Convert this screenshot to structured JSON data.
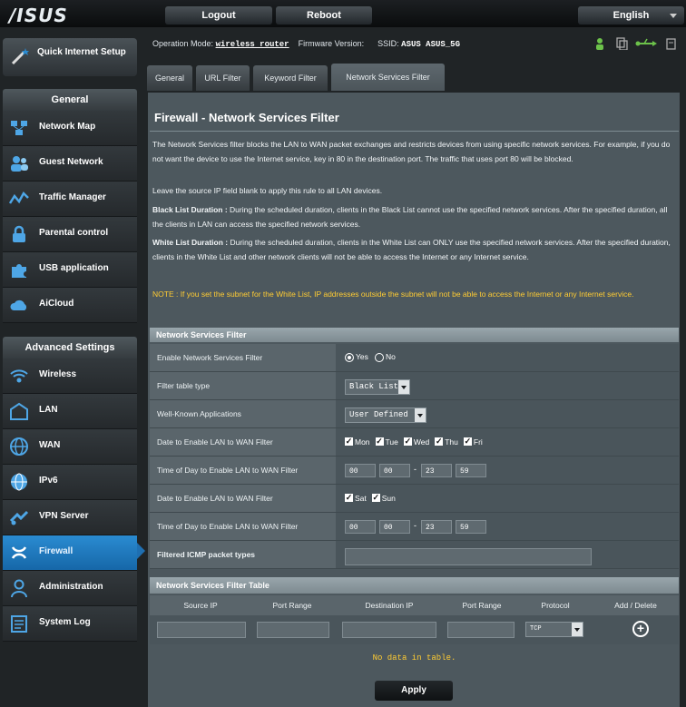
{
  "header": {
    "logo": "/ISUS",
    "logout": "Logout",
    "reboot": "Reboot",
    "language": "English"
  },
  "status": {
    "op_mode_label": "Operation Mode:",
    "op_mode_value": "wireless router",
    "firmware_label": "Firmware Version:",
    "ssid_label": "SSID:",
    "ssid_value": "ASUS  ASUS_5G"
  },
  "sidebar": {
    "quick_setup": "Quick Internet Setup",
    "general_header": "General",
    "general_items": [
      {
        "label": "Network Map",
        "icon": "network-map-icon"
      },
      {
        "label": "Guest Network",
        "icon": "guest-network-icon"
      },
      {
        "label": "Traffic Manager",
        "icon": "traffic-manager-icon"
      },
      {
        "label": "Parental control",
        "icon": "lock-icon"
      },
      {
        "label": "USB application",
        "icon": "puzzle-icon"
      },
      {
        "label": "AiCloud",
        "icon": "cloud-icon"
      }
    ],
    "advanced_header": "Advanced Settings",
    "advanced_items": [
      {
        "label": "Wireless",
        "icon": "wireless-icon"
      },
      {
        "label": "LAN",
        "icon": "lan-icon"
      },
      {
        "label": "WAN",
        "icon": "globe-icon"
      },
      {
        "label": "IPv6",
        "icon": "ipv6-globe-icon"
      },
      {
        "label": "VPN Server",
        "icon": "vpn-icon"
      },
      {
        "label": "Firewall",
        "icon": "firewall-icon",
        "active": true
      },
      {
        "label": "Administration",
        "icon": "admin-user-icon"
      },
      {
        "label": "System Log",
        "icon": "system-log-icon"
      }
    ]
  },
  "tabs": [
    {
      "label": "General"
    },
    {
      "label": "URL Filter"
    },
    {
      "label": "Keyword Filter"
    },
    {
      "label": "Network Services Filter",
      "active": true
    }
  ],
  "page": {
    "title": "Firewall - Network Services Filter",
    "intro": "The Network Services filter blocks the LAN to WAN packet exchanges and restricts devices from using specific network services. For example, if you do not want the device to use the Internet service, key in 80 in the destination port. The traffic that uses port 80 will be blocked.",
    "intro2": "Leave the source IP field blank to apply this rule to all LAN devices.",
    "black_title": "Black List Duration :",
    "black_text": "During the scheduled duration, clients in the Black List cannot use the specified network services. After the specified duration, all the clients in LAN can access the specified network services.",
    "white_title": "White List Duration :",
    "white_text": "During the scheduled duration, clients in the White List can ONLY use the specified network services. After the specified duration, clients in the White List and other network clients will not be able to access the Internet or any Internet service.",
    "note": "NOTE : If you set the subnet for the White List, IP addresses outside the subnet will not be able to access the Internet or any Internet service."
  },
  "filter_section": {
    "header": "Network Services Filter",
    "enable_label": "Enable Network Services Filter",
    "enable_yes": "Yes",
    "enable_no": "No",
    "table_type_label": "Filter table type",
    "table_type_value": "Black List",
    "well_known_label": "Well-Known Applications",
    "well_known_value": "User Defined",
    "weekday_label": "Date to Enable LAN to WAN Filter",
    "weekdays": [
      "Mon",
      "Tue",
      "Wed",
      "Thu",
      "Fri"
    ],
    "weekday_time_label": "Time of Day to Enable LAN to WAN Filter",
    "weekday_time": [
      "00",
      "00",
      "23",
      "59"
    ],
    "weekend_label": "Date to Enable LAN to WAN Filter",
    "weekend": [
      "Sat",
      "Sun"
    ],
    "weekend_time_label": "Time of Day to Enable LAN to WAN Filter",
    "weekend_time": [
      "00",
      "00",
      "23",
      "59"
    ],
    "icmp_label": "Filtered ICMP packet types",
    "icmp_value": ""
  },
  "table_section": {
    "header": "Network Services Filter Table",
    "columns": [
      "Source IP",
      "Port Range",
      "Destination IP",
      "Port Range",
      "Protocol",
      "Add / Delete"
    ],
    "protocol_value": "TCP",
    "empty_text": "No data in table."
  },
  "apply": "Apply",
  "colors": {
    "accent": "#1f6fb1",
    "note": "#ffcc33",
    "panel": "#4d585e"
  }
}
